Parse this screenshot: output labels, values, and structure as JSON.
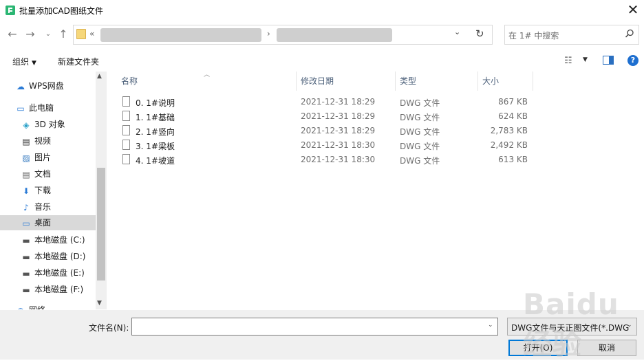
{
  "window": {
    "title": "批量添加CAD图纸文件",
    "close_symbol": "✕"
  },
  "address": {
    "prefix": "«",
    "separator": "›",
    "dropdown": "⌄",
    "refresh": "↻"
  },
  "search": {
    "placeholder": "在 1# 中搜索"
  },
  "commands": {
    "organize": "组织",
    "new_folder": "新建文件夹",
    "caret": "▼",
    "help": "?"
  },
  "nav": {
    "items": [
      {
        "label": "WPS网盘",
        "icon": "cloud-icon",
        "glyph": "☁"
      },
      {
        "label": "此电脑",
        "icon": "computer-icon",
        "glyph": "▭"
      },
      {
        "label": "3D 对象",
        "icon": "cube-icon",
        "glyph": "◈"
      },
      {
        "label": "视频",
        "icon": "video-icon",
        "glyph": "▤"
      },
      {
        "label": "图片",
        "icon": "picture-icon",
        "glyph": "▨"
      },
      {
        "label": "文档",
        "icon": "document-icon",
        "glyph": "▤"
      },
      {
        "label": "下载",
        "icon": "download-icon",
        "glyph": "⬇"
      },
      {
        "label": "音乐",
        "icon": "music-icon",
        "glyph": "♪"
      },
      {
        "label": "桌面",
        "icon": "desktop-icon",
        "glyph": "▭"
      },
      {
        "label": "本地磁盘 (C:)",
        "icon": "drive-icon",
        "glyph": "▬"
      },
      {
        "label": "本地磁盘 (D:)",
        "icon": "drive-icon",
        "glyph": "▬"
      },
      {
        "label": "本地磁盘 (E:)",
        "icon": "drive-icon",
        "glyph": "▬"
      },
      {
        "label": "本地磁盘 (F:)",
        "icon": "drive-icon",
        "glyph": "▬"
      },
      {
        "label": "网络",
        "icon": "network-icon",
        "glyph": "◍"
      }
    ],
    "selected": "桌面"
  },
  "columns": {
    "name": "名称",
    "date": "修改日期",
    "type": "类型",
    "size": "大小"
  },
  "files": [
    {
      "name": "0. 1#说明",
      "date": "2021-12-31 18:29",
      "type": "DWG 文件",
      "size": "867 KB"
    },
    {
      "name": "1. 1#基础",
      "date": "2021-12-31 18:29",
      "type": "DWG 文件",
      "size": "624 KB"
    },
    {
      "name": "2. 1#竖向",
      "date": "2021-12-31 18:29",
      "type": "DWG 文件",
      "size": "2,783 KB"
    },
    {
      "name": "3. 1#梁板",
      "date": "2021-12-31 18:30",
      "type": "DWG 文件",
      "size": "2,492 KB"
    },
    {
      "name": "4. 1#坡道",
      "date": "2021-12-31 18:30",
      "type": "DWG 文件",
      "size": "613 KB"
    }
  ],
  "footer": {
    "filename_label": "文件名(N):",
    "filename_value": "",
    "file_type": "DWG文件与天正图文件(*.DWG",
    "open": "打开(O)",
    "cancel": "取消"
  },
  "watermark": "Baidu经验"
}
